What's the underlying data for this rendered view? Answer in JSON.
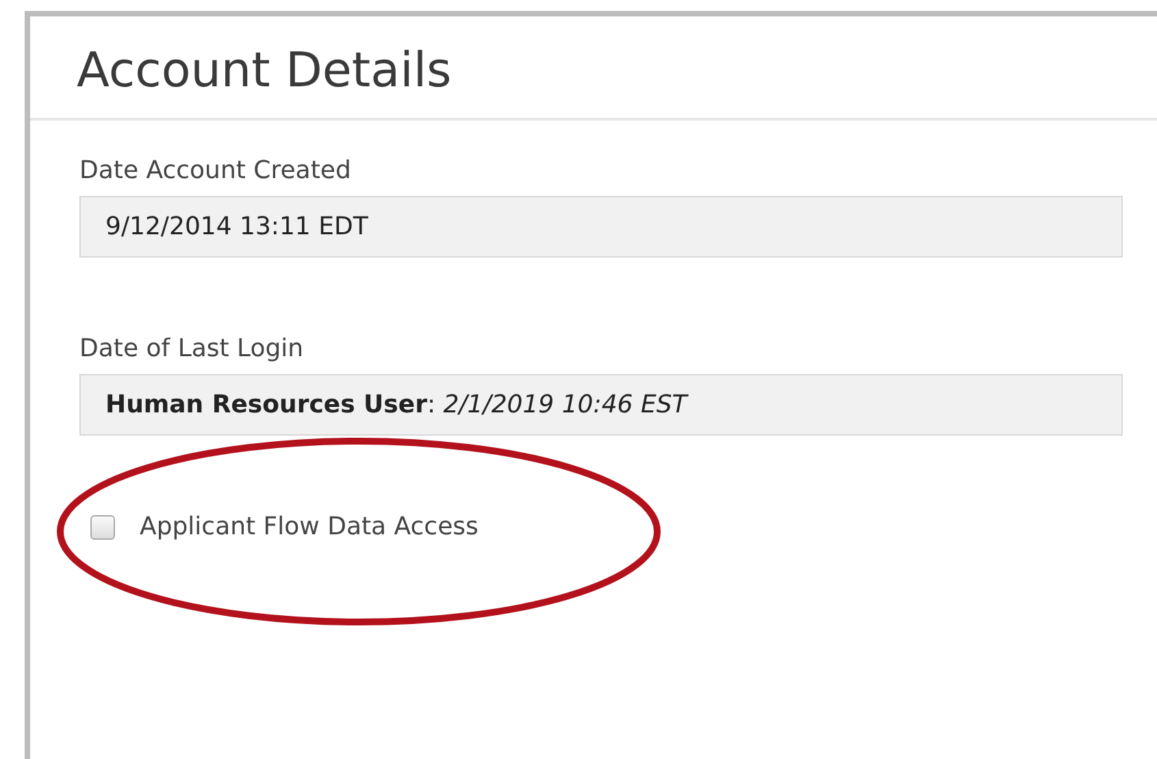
{
  "panel": {
    "title": "Account Details"
  },
  "fields": [
    {
      "label": "Date Account Created",
      "value": "9/12/2014 13:11 EDT"
    },
    {
      "label": "Date of Last Login",
      "value": "**Human Resources User**: *2/1/2019 10:46 EST*"
    }
  ],
  "checkbox": {
    "label": "Applicant Flow Data Access",
    "checked": false
  }
}
